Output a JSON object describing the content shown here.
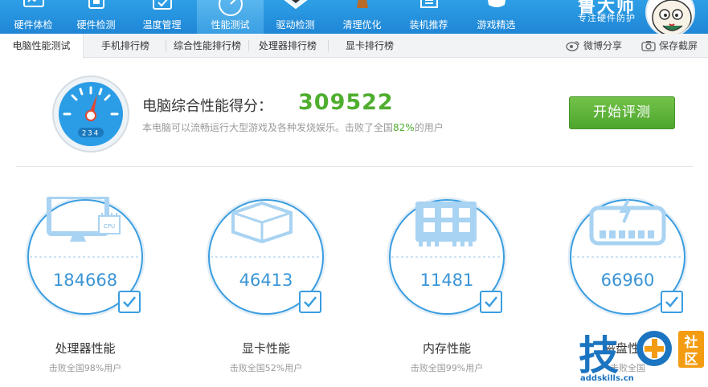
{
  "colors": {
    "nav_bg": "#1f86d6",
    "accent_blue": "#3a9de0",
    "score_green": "#4fae2f",
    "button_green": "#5cb337"
  },
  "nav": {
    "items": [
      {
        "label": "硬件体检",
        "icon": "monitor-icon"
      },
      {
        "label": "硬件检测",
        "icon": "chip-icon"
      },
      {
        "label": "温度管理",
        "icon": "thermometer-icon"
      },
      {
        "label": "性能测试",
        "icon": "gauge-icon",
        "active": true
      },
      {
        "label": "驱动检测",
        "icon": "driver-icon"
      },
      {
        "label": "清理优化",
        "icon": "broom-icon"
      },
      {
        "label": "装机推荐",
        "icon": "computer-icon"
      },
      {
        "label": "游戏精选",
        "icon": "gamepad-icon"
      }
    ],
    "brand_title": "鲁大师",
    "brand_subtitle": "专注硬件防护"
  },
  "subtabs": {
    "items": [
      {
        "label": "电脑性能测试",
        "active": true
      },
      {
        "label": "手机排行榜"
      },
      {
        "label": "综合性能排行榜"
      },
      {
        "label": "处理器排行榜"
      },
      {
        "label": "显卡排行榜"
      }
    ],
    "share_label": "微博分享",
    "screenshot_label": "保存截屏"
  },
  "score": {
    "title": "电脑综合性能得分：",
    "value": "309522",
    "desc_prefix": "本电脑可以流畅运行大型游戏及各种发烧娱乐。击败了全国",
    "desc_percent": "82%",
    "desc_suffix": "的用户",
    "gauge_text": "234"
  },
  "start_button": "开始评测",
  "components": [
    {
      "value": "184668",
      "label": "处理器性能",
      "sub": "击败全国98%用户",
      "icon": "cpu-monitor-icon",
      "chip_text": "CPU"
    },
    {
      "value": "46413",
      "label": "显卡性能",
      "sub": "击败全国52%用户",
      "icon": "graphics-cube-icon"
    },
    {
      "value": "11481",
      "label": "内存性能",
      "sub": "击败全国99%用户",
      "icon": "memory-chip-icon"
    },
    {
      "value": "66960",
      "label": "磁盘性能",
      "sub": "击败全国",
      "icon": "disk-icon"
    }
  ],
  "watermark": {
    "glyph": "技",
    "badge_top": "社",
    "badge_bottom": "区",
    "url": "addskills.cn"
  }
}
